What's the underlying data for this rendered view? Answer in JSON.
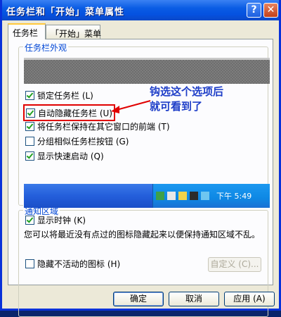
{
  "window": {
    "title": "任务栏和「开始」菜单属性",
    "accent_color": "#0a5ce4",
    "help_label": "?",
    "close_label": "✕"
  },
  "tabs": [
    {
      "label": "任务栏",
      "active": true
    },
    {
      "label": "「开始」菜单",
      "active": false
    }
  ],
  "appearance": {
    "group_label": "任务栏外观",
    "options": [
      {
        "label": "锁定任务栏 (L)",
        "checked": true
      },
      {
        "label": "自动隐藏任务栏 (U)",
        "checked": true,
        "highlighted": true
      },
      {
        "label": "将任务栏保持在其它窗口的前端 (T)",
        "checked": true
      },
      {
        "label": "分组相似任务栏按钮 (G)",
        "checked": false
      },
      {
        "label": "显示快速启动 (Q)",
        "checked": true
      }
    ]
  },
  "annotation": {
    "line1": "钩选这个选项后",
    "line2": "就可看到了",
    "color": "#1e3ec8"
  },
  "notification": {
    "group_label": "通知区域",
    "tray_time": "下午  5:49",
    "show_clock_label": "显示时钟 (K)",
    "show_clock_checked": true,
    "description": "您可以将最近没有点过的图标隐藏起来以便保持通知区域不乱。",
    "hide_inactive_label": "隐藏不活动的图标 (H)",
    "hide_inactive_checked": false,
    "customize_label": "自定义 (C)..."
  },
  "buttons": {
    "ok": "确定",
    "cancel": "取消",
    "apply": "应用 (A)"
  }
}
